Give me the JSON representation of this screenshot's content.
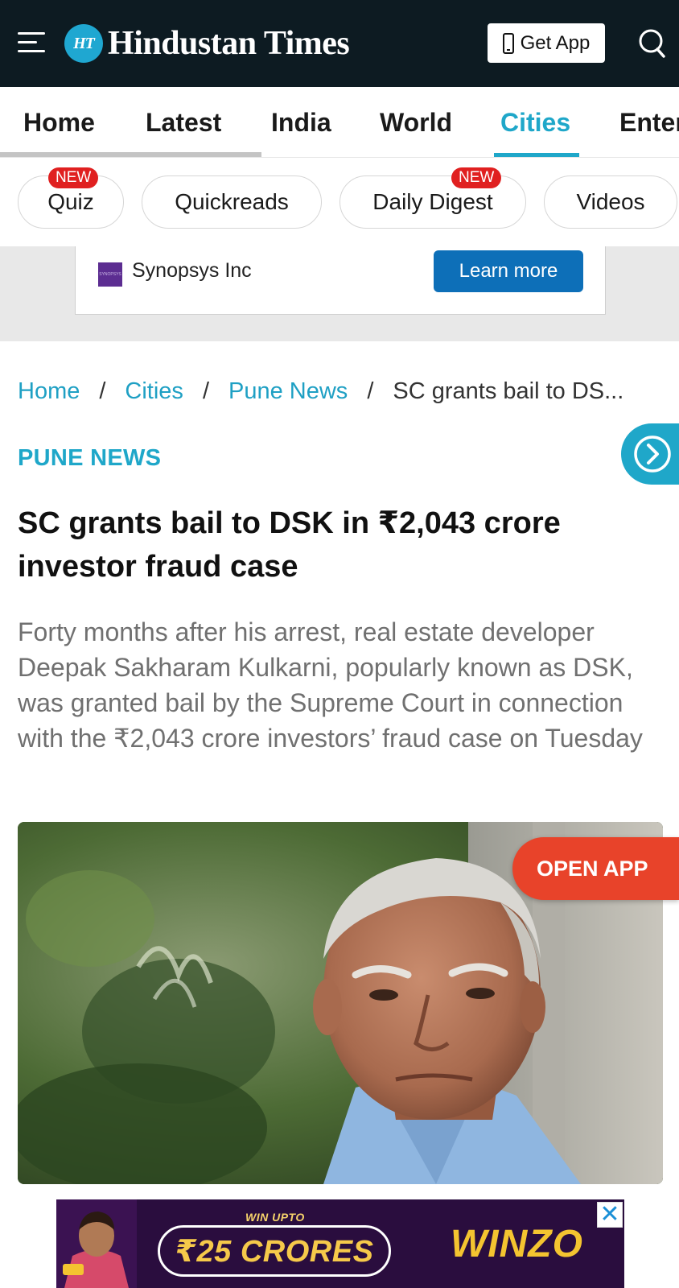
{
  "header": {
    "logo_badge": "HT",
    "logo_text": "Hindustan Times",
    "get_app_label": "Get App"
  },
  "nav": {
    "items": [
      {
        "label": "Home"
      },
      {
        "label": "Latest"
      },
      {
        "label": "India"
      },
      {
        "label": "World"
      },
      {
        "label": "Cities",
        "active": true
      },
      {
        "label": "Enter"
      }
    ],
    "active_color": "#1fa7c9"
  },
  "chips": [
    {
      "label": "Quiz",
      "badge": "NEW"
    },
    {
      "label": "Quickreads"
    },
    {
      "label": "Daily Digest",
      "badge": "NEW"
    },
    {
      "label": "Videos"
    }
  ],
  "ad_top": {
    "logo_text": "SYNOPSYS",
    "advertiser": "Synopsys Inc",
    "cta": "Learn more"
  },
  "breadcrumb": {
    "home": "Home",
    "cities": "Cities",
    "pune": "Pune News",
    "current": "SC grants bail to DS...",
    "separator": "/"
  },
  "article": {
    "section": "PUNE NEWS",
    "headline": "SC grants bail to DSK in ₹2,043 crore investor fraud case",
    "summary": "Forty months after his arrest, real estate developer Deepak Sakharam Kulkarni, popularly known as DSK, was granted bail by the Supreme Court in connection with the ₹2,043 crore investors’ fraud case on Tuesday"
  },
  "open_app_label": "OPEN APP",
  "ad_bottom": {
    "win_upto": "WIN UPTO",
    "amount": "₹25 CRORES",
    "brand": "WINZO",
    "close": "✕"
  },
  "colors": {
    "header_bg": "#0d1b22",
    "accent": "#1fa7c9",
    "open_app": "#e8432a",
    "new_badge": "#e02020",
    "cta_blue": "#0d6fb8"
  }
}
